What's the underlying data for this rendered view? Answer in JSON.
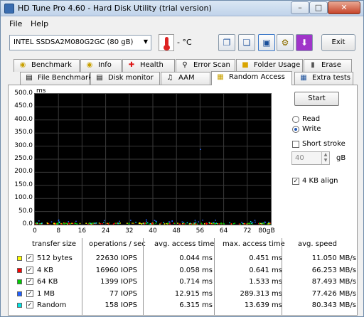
{
  "window": {
    "title": "HD Tune Pro 4.60 - Hard Disk Utility (trial version)"
  },
  "menu": {
    "file": "File",
    "help": "Help"
  },
  "toolbar": {
    "drive": "INTEL SSDSA2M080G2GC (80 gB)",
    "temperature": "- °C",
    "exit_label": "Exit"
  },
  "tabs_row1": [
    {
      "label": "Benchmark",
      "icon": "benchmark-icon"
    },
    {
      "label": "Info",
      "icon": "info-icon"
    },
    {
      "label": "Health",
      "icon": "health-icon"
    },
    {
      "label": "Error Scan",
      "icon": "magnifier-icon"
    },
    {
      "label": "Folder Usage",
      "icon": "folder-icon"
    },
    {
      "label": "Erase",
      "icon": "erase-icon"
    }
  ],
  "tabs_row2": [
    {
      "label": "File Benchmark",
      "icon": "file-icon"
    },
    {
      "label": "Disk monitor",
      "icon": "monitor-icon"
    },
    {
      "label": "AAM",
      "icon": "speaker-icon"
    },
    {
      "label": "Random Access",
      "icon": "random-access-icon"
    },
    {
      "label": "Extra tests",
      "icon": "extra-tests-icon"
    }
  ],
  "active_tab": "Random Access",
  "controls": {
    "start_label": "Start",
    "read_label": "Read",
    "write_label": "Write",
    "selected_mode": "Write",
    "short_stroke_label": "Short stroke",
    "short_stroke_checked": false,
    "stroke_value": "40",
    "stroke_unit": "gB",
    "align_label": "4 KB align",
    "align_checked": true
  },
  "chart_data": {
    "type": "scatter",
    "title": "",
    "xlabel": "",
    "ylabel": "ms",
    "x_ticks": [
      "0",
      "8",
      "16",
      "24",
      "32",
      "40",
      "48",
      "56",
      "64",
      "72",
      "80gB"
    ],
    "y_ticks": [
      "500.0",
      "450.0",
      "400.0",
      "350.0",
      "300.0",
      "250.0",
      "200.0",
      "150.0",
      "100.0",
      "50.0",
      "0.0"
    ],
    "xlim": [
      0,
      80
    ],
    "ylim": [
      0,
      500
    ],
    "grid": true,
    "background": "#000000",
    "series": [
      {
        "name": "512 bytes",
        "color": "#ffff00",
        "typical_ms": 0.044,
        "max_ms": 0.451
      },
      {
        "name": "4 KB",
        "color": "#ff0000",
        "typical_ms": 0.058,
        "max_ms": 0.641
      },
      {
        "name": "64 KB",
        "color": "#00cc00",
        "typical_ms": 0.714,
        "max_ms": 1.533
      },
      {
        "name": "1 MB",
        "color": "#2060ff",
        "typical_ms": 12.915,
        "max_ms": 289.313
      },
      {
        "name": "Random",
        "color": "#00e5e5",
        "typical_ms": 6.315,
        "max_ms": 13.639
      }
    ]
  },
  "results": {
    "headers": [
      "transfer size",
      "operations / sec",
      "avg. access time",
      "max. access time",
      "avg. speed"
    ],
    "rows": [
      {
        "size": "512 bytes",
        "color": "#ffff00",
        "ops": "22630 IOPS",
        "avg": "0.044 ms",
        "max": "0.451 ms",
        "speed": "11.050 MB/s"
      },
      {
        "size": "4 KB",
        "color": "#ff0000",
        "ops": "16960 IOPS",
        "avg": "0.058 ms",
        "max": "0.641 ms",
        "speed": "66.253 MB/s"
      },
      {
        "size": "64 KB",
        "color": "#00cc00",
        "ops": "1399 IOPS",
        "avg": "0.714 ms",
        "max": "1.533 ms",
        "speed": "87.493 MB/s"
      },
      {
        "size": "1 MB",
        "color": "#2060ff",
        "ops": "77 IOPS",
        "avg": "12.915 ms",
        "max": "289.313 ms",
        "speed": "77.426 MB/s"
      },
      {
        "size": "Random",
        "color": "#00e5e5",
        "ops": "158 IOPS",
        "avg": "6.315 ms",
        "max": "13.639 ms",
        "speed": "80.343 MB/s"
      }
    ]
  }
}
